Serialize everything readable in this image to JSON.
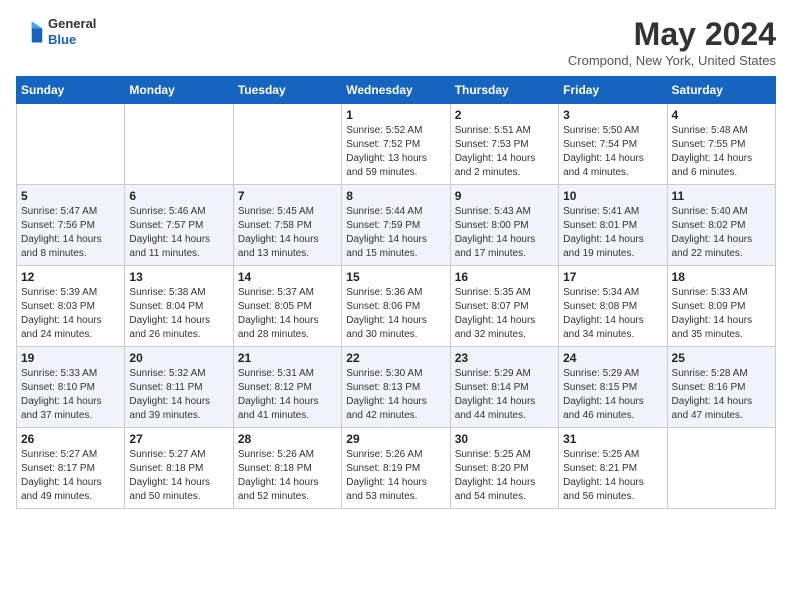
{
  "header": {
    "logo_general": "General",
    "logo_blue": "Blue",
    "month": "May 2024",
    "location": "Crompond, New York, United States"
  },
  "days_of_week": [
    "Sunday",
    "Monday",
    "Tuesday",
    "Wednesday",
    "Thursday",
    "Friday",
    "Saturday"
  ],
  "weeks": [
    [
      {
        "day": "",
        "info": ""
      },
      {
        "day": "",
        "info": ""
      },
      {
        "day": "",
        "info": ""
      },
      {
        "day": "1",
        "info": "Sunrise: 5:52 AM\nSunset: 7:52 PM\nDaylight: 13 hours and 59 minutes."
      },
      {
        "day": "2",
        "info": "Sunrise: 5:51 AM\nSunset: 7:53 PM\nDaylight: 14 hours and 2 minutes."
      },
      {
        "day": "3",
        "info": "Sunrise: 5:50 AM\nSunset: 7:54 PM\nDaylight: 14 hours and 4 minutes."
      },
      {
        "day": "4",
        "info": "Sunrise: 5:48 AM\nSunset: 7:55 PM\nDaylight: 14 hours and 6 minutes."
      }
    ],
    [
      {
        "day": "5",
        "info": "Sunrise: 5:47 AM\nSunset: 7:56 PM\nDaylight: 14 hours and 8 minutes."
      },
      {
        "day": "6",
        "info": "Sunrise: 5:46 AM\nSunset: 7:57 PM\nDaylight: 14 hours and 11 minutes."
      },
      {
        "day": "7",
        "info": "Sunrise: 5:45 AM\nSunset: 7:58 PM\nDaylight: 14 hours and 13 minutes."
      },
      {
        "day": "8",
        "info": "Sunrise: 5:44 AM\nSunset: 7:59 PM\nDaylight: 14 hours and 15 minutes."
      },
      {
        "day": "9",
        "info": "Sunrise: 5:43 AM\nSunset: 8:00 PM\nDaylight: 14 hours and 17 minutes."
      },
      {
        "day": "10",
        "info": "Sunrise: 5:41 AM\nSunset: 8:01 PM\nDaylight: 14 hours and 19 minutes."
      },
      {
        "day": "11",
        "info": "Sunrise: 5:40 AM\nSunset: 8:02 PM\nDaylight: 14 hours and 22 minutes."
      }
    ],
    [
      {
        "day": "12",
        "info": "Sunrise: 5:39 AM\nSunset: 8:03 PM\nDaylight: 14 hours and 24 minutes."
      },
      {
        "day": "13",
        "info": "Sunrise: 5:38 AM\nSunset: 8:04 PM\nDaylight: 14 hours and 26 minutes."
      },
      {
        "day": "14",
        "info": "Sunrise: 5:37 AM\nSunset: 8:05 PM\nDaylight: 14 hours and 28 minutes."
      },
      {
        "day": "15",
        "info": "Sunrise: 5:36 AM\nSunset: 8:06 PM\nDaylight: 14 hours and 30 minutes."
      },
      {
        "day": "16",
        "info": "Sunrise: 5:35 AM\nSunset: 8:07 PM\nDaylight: 14 hours and 32 minutes."
      },
      {
        "day": "17",
        "info": "Sunrise: 5:34 AM\nSunset: 8:08 PM\nDaylight: 14 hours and 34 minutes."
      },
      {
        "day": "18",
        "info": "Sunrise: 5:33 AM\nSunset: 8:09 PM\nDaylight: 14 hours and 35 minutes."
      }
    ],
    [
      {
        "day": "19",
        "info": "Sunrise: 5:33 AM\nSunset: 8:10 PM\nDaylight: 14 hours and 37 minutes."
      },
      {
        "day": "20",
        "info": "Sunrise: 5:32 AM\nSunset: 8:11 PM\nDaylight: 14 hours and 39 minutes."
      },
      {
        "day": "21",
        "info": "Sunrise: 5:31 AM\nSunset: 8:12 PM\nDaylight: 14 hours and 41 minutes."
      },
      {
        "day": "22",
        "info": "Sunrise: 5:30 AM\nSunset: 8:13 PM\nDaylight: 14 hours and 42 minutes."
      },
      {
        "day": "23",
        "info": "Sunrise: 5:29 AM\nSunset: 8:14 PM\nDaylight: 14 hours and 44 minutes."
      },
      {
        "day": "24",
        "info": "Sunrise: 5:29 AM\nSunset: 8:15 PM\nDaylight: 14 hours and 46 minutes."
      },
      {
        "day": "25",
        "info": "Sunrise: 5:28 AM\nSunset: 8:16 PM\nDaylight: 14 hours and 47 minutes."
      }
    ],
    [
      {
        "day": "26",
        "info": "Sunrise: 5:27 AM\nSunset: 8:17 PM\nDaylight: 14 hours and 49 minutes."
      },
      {
        "day": "27",
        "info": "Sunrise: 5:27 AM\nSunset: 8:18 PM\nDaylight: 14 hours and 50 minutes."
      },
      {
        "day": "28",
        "info": "Sunrise: 5:26 AM\nSunset: 8:18 PM\nDaylight: 14 hours and 52 minutes."
      },
      {
        "day": "29",
        "info": "Sunrise: 5:26 AM\nSunset: 8:19 PM\nDaylight: 14 hours and 53 minutes."
      },
      {
        "day": "30",
        "info": "Sunrise: 5:25 AM\nSunset: 8:20 PM\nDaylight: 14 hours and 54 minutes."
      },
      {
        "day": "31",
        "info": "Sunrise: 5:25 AM\nSunset: 8:21 PM\nDaylight: 14 hours and 56 minutes."
      },
      {
        "day": "",
        "info": ""
      }
    ]
  ]
}
